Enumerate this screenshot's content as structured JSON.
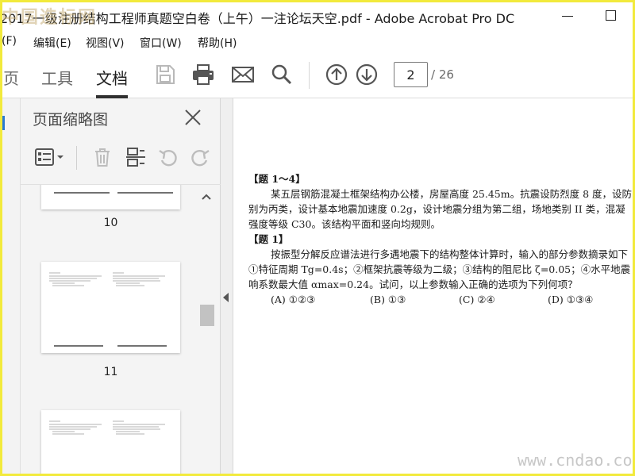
{
  "watermark_top": "中国造标网",
  "watermark_bottom": "www.cndao.com",
  "window": {
    "title": "2017一级注册结构工程师真题空白卷（上午）一注论坛天空.pdf - Adobe Acrobat Pro DC"
  },
  "menu": [
    "(F)",
    "编辑(E)",
    "视图(V)",
    "窗口(W)",
    "帮助(H)"
  ],
  "toolbar": {
    "tabs": [
      "页",
      "工具",
      "文档"
    ],
    "active_tab": "文档",
    "current_page": "2",
    "page_total": "/ 26"
  },
  "icons": {
    "save": "save-icon",
    "print": "print-icon",
    "email": "mail-icon",
    "search": "search-icon",
    "prev_page": "arrow-up-circle-icon",
    "next_page": "arrow-down-circle-icon",
    "close": "close-icon",
    "thumb_options": "list-options-icon",
    "delete": "trash-icon",
    "extract": "extract-pages-icon",
    "rotate_ccw": "rotate-left-icon",
    "rotate_cw": "rotate-right-icon"
  },
  "panel": {
    "title": "页面缩略图",
    "thumbnails": [
      {
        "label": "10"
      },
      {
        "label": "11"
      },
      {
        "label": ""
      }
    ]
  },
  "document": {
    "heading1": "【题 1～4】",
    "p1": [
      "某五层钢筋混凝土框架结构办公楼，房屋高度 25.45m。抗震设防烈度 8 度，设防",
      "别为丙类，设计基本地震加速度 0.2g，设计地震分组为第二组，场地类别 II 类，混凝",
      "强度等级 C30。该结构平面和竖向均规则。"
    ],
    "heading2": "【题 1】",
    "p2": [
      "按振型分解反应谱法进行多遇地震下的结构整体计算时，输入的部分参数摘录如下",
      "①特征周期 Tg=0.4s；②框架抗震等级为二级；③结构的阻尼比 ζ=0.05；④水平地震",
      "响系数最大值 αmax=0.24。试问，以上参数输入正确的选项为下列何项？"
    ],
    "options": [
      "(A) ①②③",
      "(B) ①③",
      "(C) ②④",
      "(D) ①③④"
    ]
  }
}
